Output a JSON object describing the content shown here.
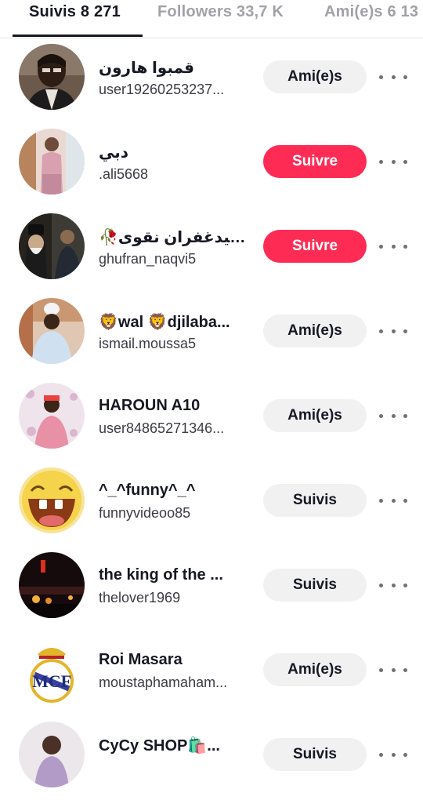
{
  "tabs": [
    {
      "label": "Suivis 8 271",
      "active": true
    },
    {
      "label": "Followers 33,7 K",
      "active": false
    },
    {
      "label": "Ami(e)s 6 13",
      "active": false
    }
  ],
  "colors": {
    "accent": "#fe2c55",
    "button_gray": "#f1f1f2",
    "text": "#161823",
    "muted": "#a1a2a7"
  },
  "users": [
    {
      "name": "قمبوا هارون",
      "handle": "user19260253237...",
      "button": "Ami(e)s",
      "style": "gray"
    },
    {
      "name": "دبي",
      "handle": ".ali5668",
      "button": "Suivre",
      "style": "red"
    },
    {
      "name": "🥀سيدغفران نقوی...",
      "handle": "ghufran_naqvi5",
      "button": "Suivre",
      "style": "red"
    },
    {
      "name": "🦁wal 🦁djilaba...",
      "handle": "ismail.moussa5",
      "button": "Ami(e)s",
      "style": "gray"
    },
    {
      "name": "HAROUN A10",
      "handle": "user84865271346...",
      "button": "Ami(e)s",
      "style": "gray"
    },
    {
      "name": "^_^funny^_^",
      "handle": "funnyvideoo85",
      "button": "Suivis",
      "style": "gray"
    },
    {
      "name": "the king of the ...",
      "handle": "thelover1969",
      "button": "Suivis",
      "style": "gray"
    },
    {
      "name": "Roi Masara",
      "handle": "moustaphamaham...",
      "button": "Ami(e)s",
      "style": "gray"
    },
    {
      "name": "CyCy SHOP🛍️...",
      "handle": "",
      "button": "Suivis",
      "style": "gray"
    }
  ]
}
